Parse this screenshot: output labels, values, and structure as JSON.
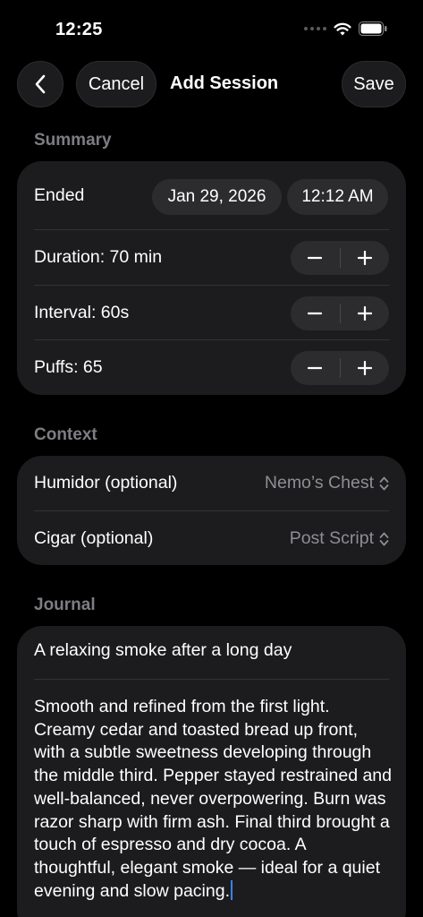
{
  "status_bar": {
    "time": "12:25"
  },
  "nav": {
    "cancel_label": "Cancel",
    "title": "Add Session",
    "save_label": "Save"
  },
  "summary": {
    "header": "Summary",
    "ended_label": "Ended",
    "ended_date": "Jan 29, 2026",
    "ended_time": "12:12 AM",
    "duration_label": "Duration: 70 min",
    "interval_label": "Interval: 60s",
    "puffs_label": "Puffs: 65"
  },
  "context": {
    "header": "Context",
    "humidor_label": "Humidor (optional)",
    "humidor_value": "Nemo’s Chest",
    "cigar_label": "Cigar (optional)",
    "cigar_value": "Post Script"
  },
  "journal": {
    "header": "Journal",
    "title_value": "A relaxing smoke after a long day",
    "body_value": "Smooth and refined from the first light. Creamy cedar and toasted bread up front, with a subtle sweetness developing through the middle third. Pepper stayed restrained and well-balanced, never overpowering. Burn was razor sharp with firm ash. Final third brought a touch of espresso and dry cocoa. A thoughtful, elegant smoke — ideal for a quiet evening and slow pacing."
  },
  "icons": {
    "back": "chevron-left-icon",
    "stepper_minus": "minus-icon",
    "stepper_plus": "plus-icon",
    "picker": "chevron-up-down-icon",
    "wifi": "wifi-icon",
    "battery": "battery-icon"
  },
  "colors": {
    "background": "#000000",
    "card": "#1c1c1e",
    "secondary_text": "#8e8e93",
    "caret": "#3b82f6"
  }
}
